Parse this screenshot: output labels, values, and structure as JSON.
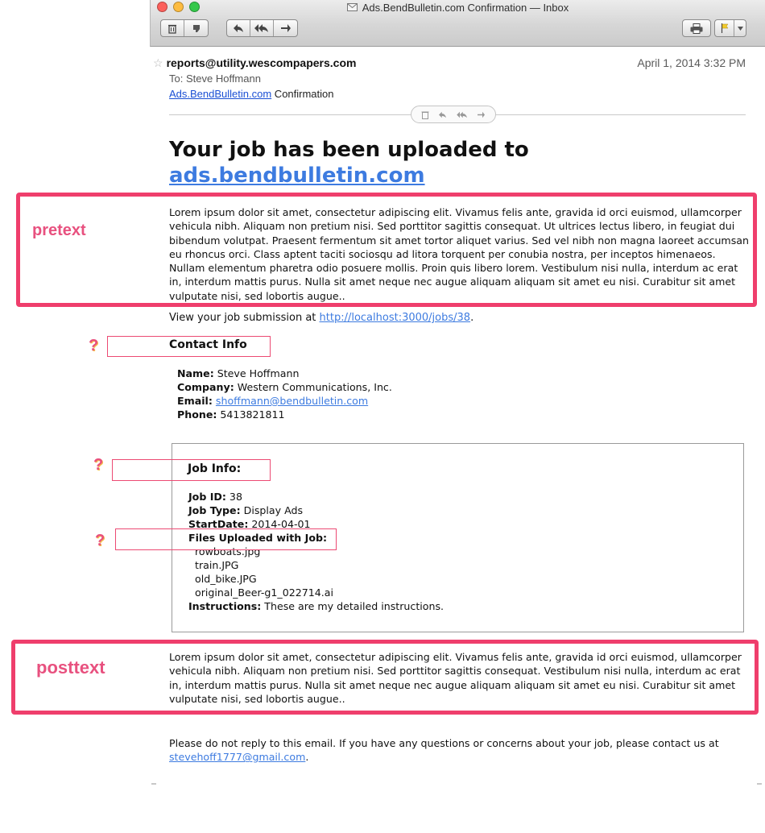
{
  "window": {
    "title": "Ads.BendBulletin.com Confirmation — Inbox"
  },
  "header": {
    "from": "reports@utility.wescompapers.com",
    "date": "April 1, 2014  3:32 PM",
    "to_label": "To:",
    "to_name": "Steve Hoffmann",
    "subject_link": "Ads.BendBulletin.com",
    "subject_rest": " Confirmation"
  },
  "body": {
    "headline_prefix": "Your job has been uploaded to",
    "headline_link": "ads.bendbulletin.com",
    "pretext": "Lorem ipsum dolor sit amet, consectetur adipiscing elit. Vivamus felis ante, gravida id orci euismod, ullamcorper vehicula nibh. Aliquam non pretium nisi. Sed porttitor sagittis consequat. Ut ultrices lectus libero, in feugiat dui bibendum volutpat. Praesent fermentum sit amet tortor aliquet varius. Sed vel nibh non magna laoreet accumsan eu rhoncus orci. Class aptent taciti sociosqu ad litora torquent per conubia nostra, per inceptos himenaeos. Nullam elementum pharetra odio posuere mollis. Proin quis libero lorem. Vestibulum nisi nulla, interdum ac erat in, interdum mattis purus. Nulla sit amet neque nec augue aliquam aliquam sit amet eu nisi. Curabitur sit amet vulputate nisi, sed lobortis augue..",
    "view_prefix": "View your job submission at ",
    "view_link": "http://localhost:3000/jobs/38",
    "view_suffix": ".",
    "contact": {
      "heading": "Contact Info",
      "name_label": "Name:",
      "name": " Steve Hoffmann",
      "company_label": "Company:",
      "company": " Western Communications, Inc.",
      "email_label": "Email:",
      "email": "shoffmann@bendbulletin.com",
      "phone_label": "Phone:",
      "phone": " 5413821811"
    },
    "job": {
      "heading": "Job Info:",
      "id_label": "Job ID:",
      "id": " 38",
      "type_label": "Job Type:",
      "type": " Display Ads",
      "start_label": "StartDate:",
      "start": " 2014-04-01",
      "files_label": "Files Uploaded with Job:",
      "files": [
        "rowboats.jpg",
        "train.JPG",
        "old_bike.JPG",
        "original_Beer-g1_022714.ai"
      ],
      "instructions_label": "Instructions:",
      "instructions": " These are my detailed instructions."
    },
    "posttext": "Lorem ipsum dolor sit amet, consectetur adipiscing elit. Vivamus felis ante, gravida id orci euismod, ullamcorper vehicula nibh. Aliquam non pretium nisi. Sed porttitor sagittis consequat. Vestibulum nisi nulla, interdum ac erat in, interdum mattis purus. Nulla sit amet neque nec augue aliquam aliquam sit amet eu nisi. Curabitur sit amet vulputate nisi, sed lobortis augue..",
    "footer_text": "Please do not reply to this email. If you have any questions or concerns about your job, please contact us at ",
    "footer_email": "stevehoff1777@gmail.com",
    "footer_suffix": "."
  },
  "annotations": {
    "pretext_label": "pretext",
    "posttext_label": "posttext",
    "question_mark": "?"
  },
  "colors": {
    "link": "#3d7be0",
    "annotation": "#ef3e6c"
  },
  "icons": [
    "close-light",
    "minimize-light",
    "zoom-light",
    "envelope-icon",
    "trash-icon",
    "junk-icon",
    "reply-icon",
    "reply-all-icon",
    "forward-icon",
    "print-icon",
    "flag-icon",
    "star-icon"
  ]
}
